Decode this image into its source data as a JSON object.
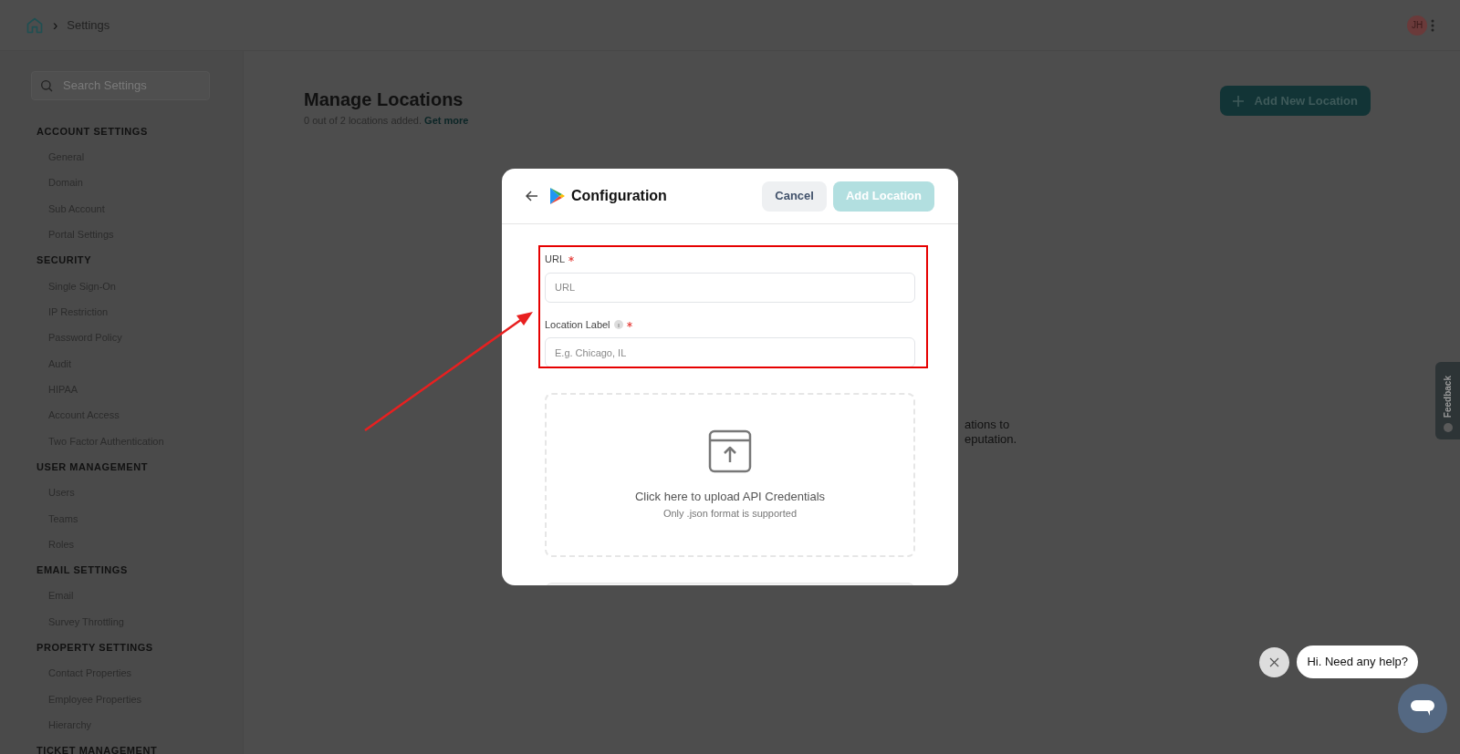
{
  "breadcrumb": {
    "separator": "›",
    "current": "Settings"
  },
  "user": {
    "initials": "JH"
  },
  "sidebar": {
    "search_placeholder": "Search Settings",
    "sections": [
      {
        "title": "ACCOUNT SETTINGS",
        "items": [
          "General",
          "Domain",
          "Sub Account",
          "Portal Settings"
        ]
      },
      {
        "title": "SECURITY",
        "items": [
          "Single Sign-On",
          "IP Restriction",
          "Password Policy",
          "Audit",
          "HIPAA",
          "Account Access",
          "Two Factor Authentication"
        ]
      },
      {
        "title": "USER MANAGEMENT",
        "items": [
          "Users",
          "Teams",
          "Roles"
        ]
      },
      {
        "title": "EMAIL SETTINGS",
        "items": [
          "Email",
          "Survey Throttling"
        ]
      },
      {
        "title": "PROPERTY SETTINGS",
        "items": [
          "Contact Properties",
          "Employee Properties",
          "Hierarchy"
        ]
      },
      {
        "title": "TICKET MANAGEMENT"
      }
    ]
  },
  "page": {
    "title": "Manage Locations",
    "subtitle": "0 out of 2 locations added.",
    "link": "Get more",
    "add_button": "Add New Location",
    "empty_text_lines": [
      "ations to",
      "eputation."
    ]
  },
  "modal": {
    "title": "Configuration",
    "cancel": "Cancel",
    "submit": {
      "label": "Add Location",
      "disabled": true
    },
    "fields": [
      {
        "label": "URL",
        "required": true,
        "info": false,
        "placeholder": "URL"
      },
      {
        "label": "Location Label",
        "required": true,
        "info": true,
        "placeholder": "E.g. Chicago, IL"
      }
    ],
    "upload": {
      "title": "Click here to upload API Credentials",
      "hint": "Only .json format is supported"
    }
  },
  "feedback_tab": "Feedback",
  "chat": {
    "message": "Hi. Need any help?"
  }
}
